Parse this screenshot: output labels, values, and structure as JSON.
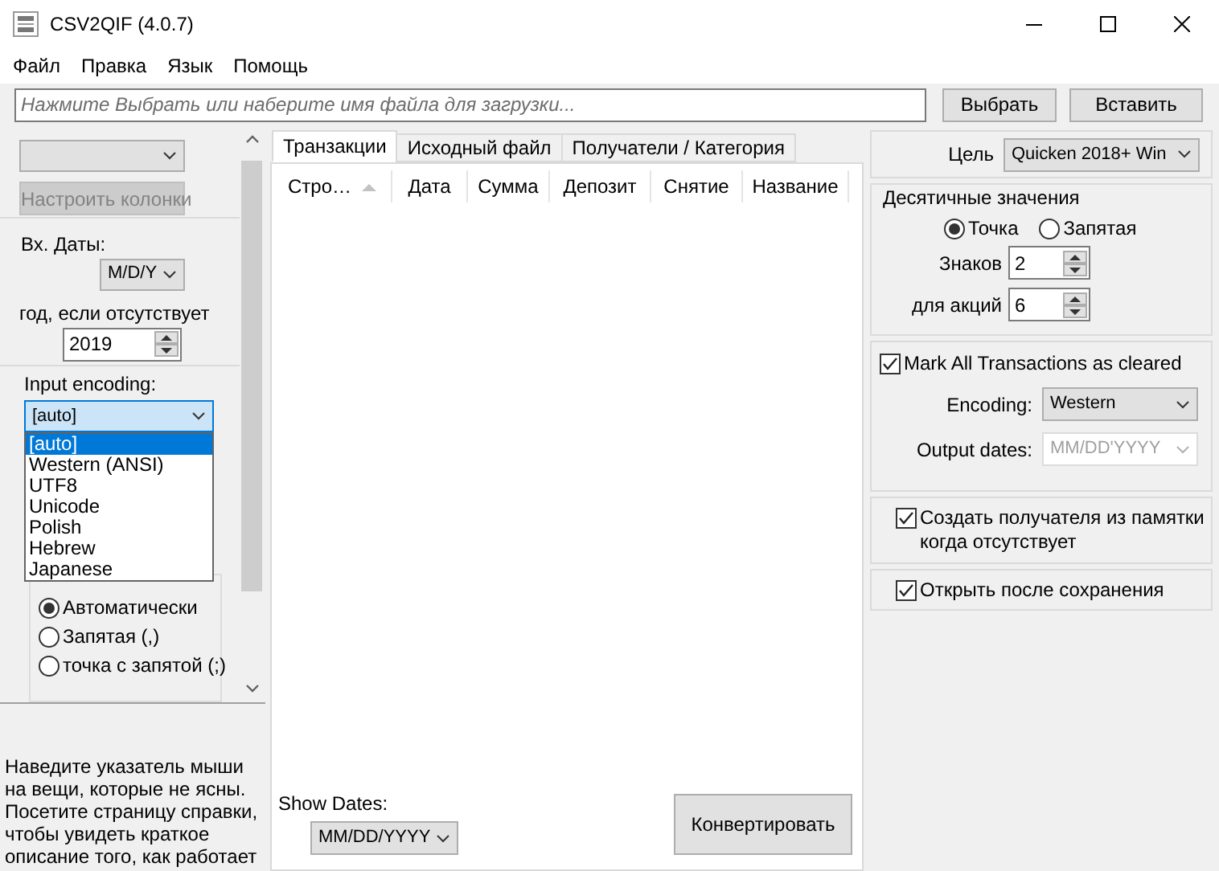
{
  "window": {
    "title": "CSV2QIF (4.0.7)"
  },
  "menu": [
    "Файл",
    "Правка",
    "Язык",
    "Помощь"
  ],
  "file_bar": {
    "placeholder": "Нажмите Выбрать или наберите имя файла для загрузки...",
    "buttons": [
      "Выбрать",
      "Вставить"
    ]
  },
  "left_panel": {
    "customize_button": {
      "label": "Настроить колонки",
      "disabled": true
    },
    "input_dates": {
      "label": "Вх. Даты:",
      "value": "M/D/Y"
    },
    "year_if_missing": {
      "label": "год, если отсутствует",
      "value": "2019"
    },
    "input_encoding": {
      "label": "Input encoding:",
      "value": "[auto]",
      "expanded": true,
      "options": [
        {
          "label": "[auto]",
          "selected": true
        },
        {
          "label": "Western (ANSI)",
          "selected": false
        },
        {
          "label": "UTF8",
          "selected": false
        },
        {
          "label": "Unicode",
          "selected": false
        },
        {
          "label": "Polish",
          "selected": false
        },
        {
          "label": "Hebrew",
          "selected": false
        },
        {
          "label": "Japanese",
          "selected": false
        }
      ]
    },
    "field_separator": {
      "options": [
        {
          "label": "Автоматически",
          "selected": true
        },
        {
          "label": "Запятая (,)",
          "selected": false
        },
        {
          "label": "точка с запятой (;)",
          "selected": false
        }
      ]
    }
  },
  "help_text": "Наведите указатель мыши на вещи, которые не ясны. Посетите страницу справки, чтобы увидеть краткое описание того, как работает",
  "tabs": [
    {
      "label": "Транзакции",
      "selected": true
    },
    {
      "label": "Исходный файл",
      "selected": false
    },
    {
      "label": "Получатели / Категория",
      "selected": false
    }
  ],
  "table": {
    "columns": [
      {
        "label": "Стро…",
        "sorted": true
      },
      {
        "label": "Дата",
        "sorted": false
      },
      {
        "label": "Сумма",
        "sorted": false
      },
      {
        "label": "Депозит",
        "sorted": false
      },
      {
        "label": "Снятие",
        "sorted": false
      },
      {
        "label": "Название",
        "sorted": false
      }
    ]
  },
  "show_dates": {
    "label": "Show Dates:",
    "value": "MM/DD/YYYY"
  },
  "convert_button": "Конвертировать",
  "right_panel": {
    "target": {
      "label": "Цель",
      "value": "Quicken 2018+ Win"
    },
    "decimals": {
      "title": "Десятичные значения",
      "separator": [
        {
          "label": "Точка",
          "selected": true
        },
        {
          "label": "Запятая",
          "selected": false
        }
      ],
      "digits": {
        "label": "Знаков",
        "value": "2"
      },
      "share_digits": {
        "label": "для акций",
        "value": "6"
      }
    },
    "mark_cleared": {
      "label": "Mark All Transactions as cleared",
      "checked": true
    },
    "encoding": {
      "label": "Encoding:",
      "value": "Western"
    },
    "output_dates": {
      "label": "Output dates:",
      "value": "MM/DD'YYYY",
      "disabled": true
    },
    "create_payee": {
      "label": "Создать получателя из памятки когда отсутствует",
      "checked": true
    },
    "open_after_save": {
      "label": "Открыть после сохранения",
      "checked": true
    }
  }
}
